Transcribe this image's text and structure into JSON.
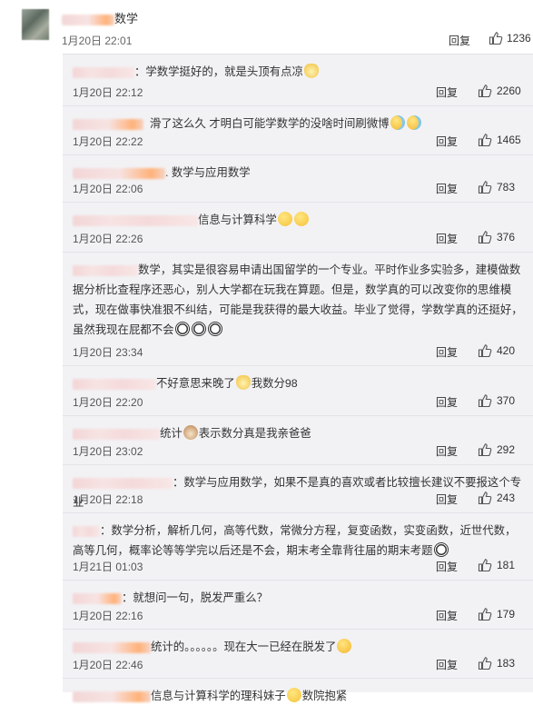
{
  "top_comment": {
    "name_suffix": "数学",
    "date": "1月20日 22:01",
    "reply_label": "回复",
    "likes": "1236"
  },
  "replies": [
    {
      "text": "学数学挺好的，就是头顶有点凉",
      "emojis": [
        "cat"
      ],
      "date": "1月20日 22:12",
      "reply_label": "回复",
      "likes": "2260"
    },
    {
      "text": "滑了这么久 才明白可能学数学的没啥时间刷微博",
      "emojis": [
        "sweat",
        "sweat"
      ],
      "date": "1月20日 22:22",
      "reply_label": "回复",
      "likes": "1465"
    },
    {
      "text": ". 数学与应用数学",
      "emojis": [],
      "date": "1月20日 22:06",
      "reply_label": "回复",
      "likes": "783"
    },
    {
      "text": "信息与计算科学",
      "emojis": [
        "bow",
        "bow"
      ],
      "date": "1月20日 22:26",
      "reply_label": "回复",
      "likes": "376"
    },
    {
      "text": "数学，其实是很容易申请出国留学的一个专业。平时作业多实验多，建模做数据分析比查程序还恶心，别人大学都在玩我在算题。但是，数学真的可以改变你的思维模式，现在做事快准狠不纠结，可能是我获得的最大收益。毕业了觉得，学数学真的还挺好，虽然我现在屁都不会",
      "emojis": [
        "panda",
        "panda",
        "panda"
      ],
      "date": "1月20日 23:34",
      "reply_label": "回复",
      "likes": "420"
    },
    {
      "text": "不好意思来晚了",
      "text2": "我数分98",
      "emojis": [
        "cat"
      ],
      "date": "1月20日 22:20",
      "reply_label": "回复",
      "likes": "370"
    },
    {
      "text": "统计",
      "text2": "表示数分真是我亲爸爸",
      "emojis": [
        "dog"
      ],
      "date": "1月20日 23:02",
      "reply_label": "回复",
      "likes": "292"
    },
    {
      "text": "：数学与应用数学，如果不是真的喜欢或者比较擅长建议不要报这个专业",
      "emojis": [],
      "date": "1月20日 22:18",
      "reply_label": "回复",
      "likes": "243"
    },
    {
      "text": "：数学分析，解析几何，高等代数，常微分方程，复变函数，实变函数，近世代数，高等几何，概率论等等学完以后还是不会，期末考全靠背往届的期末考题",
      "emojis": [
        "panda"
      ],
      "date": "1月21日 01:03",
      "reply_label": "回复",
      "likes": "181"
    },
    {
      "text": "：就想问一句，脱发严重么？",
      "emojis": [],
      "date": "1月20日 22:16",
      "reply_label": "回复",
      "likes": "179"
    },
    {
      "text": "统计的。。。。。。现在大一已经在脱发了",
      "emojis": [
        "laugh"
      ],
      "date": "1月20日 22:46",
      "reply_label": "回复",
      "likes": "183"
    },
    {
      "text": "信息与计算科学的理科妹子",
      "text2": "数院抱紧",
      "emojis": [
        "smile"
      ],
      "date": "",
      "reply_label": "",
      "likes": ""
    }
  ]
}
